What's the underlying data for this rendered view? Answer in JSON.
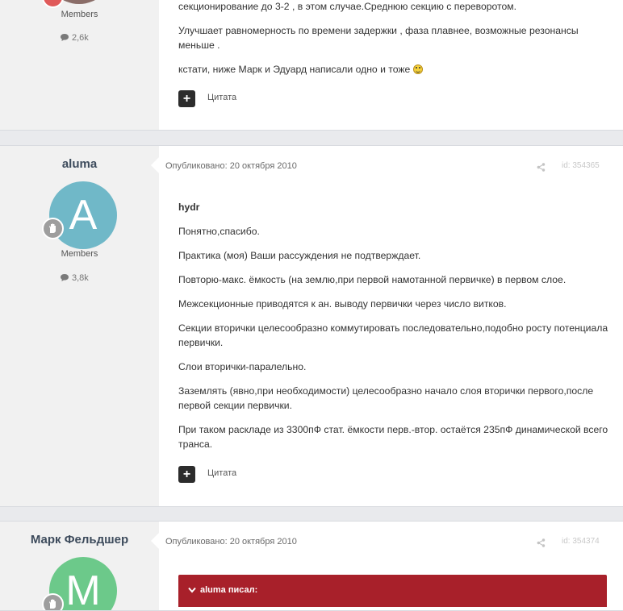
{
  "posts": [
    {
      "group": "Members",
      "reputation": "2,6k",
      "paragraphs": [
        "секционирование до 3-2 , в этом случае.Среднюю секцию с переворотом.",
        "Улучшает равномерность по времени задержки , фаза плавнее, возможные резонансы меньше .",
        "кстати, ниже Марк и Эдуард написали одно и тоже"
      ],
      "emoji": "smile-emoji",
      "quote_label": "Цитата"
    },
    {
      "author": "aluma",
      "avatar_letter": "A",
      "avatar_color": "#70b8c8",
      "group": "Members",
      "reputation": "3,8k",
      "published": "Опубликовано: 20 октября 2010",
      "post_id": "id: 354365",
      "quote_heading": "hydr",
      "paragraphs": [
        "Понятно,спасибо.",
        "Практика (моя) Ваши рассуждения не подтверждает.",
        "Повторю-макс. ёмкость (на землю,при первой намотанной первичке) в первом слое.",
        "Межсекционные приводятся к ан. выводу первички через число витков.",
        "Секции вторички целесообразно коммутировать последовательно,подобно росту потенциала первички.",
        "Слои вторички-паралельно.",
        "Заземлять (явно,при необходимости) целесообразно начало слоя вторички первого,после первой секции первички.",
        "При таком раскладе из 3300пФ стат. ёмкости перв.-втор. остаётся 235пФ динамической всего транса."
      ],
      "quote_label": "Цитата"
    },
    {
      "author": "Марк Фельдшер",
      "avatar_letter": "M",
      "avatar_color": "#6cc98a",
      "published": "Опубликовано: 20 октября 2010",
      "post_id": "id: 354374",
      "quote_block_title": "aluma писал:",
      "quote_block_color": "#a8202a"
    }
  ]
}
